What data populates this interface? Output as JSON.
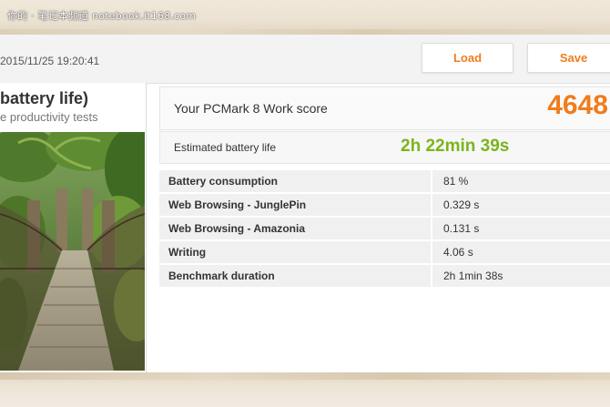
{
  "watermark": "你的 · 笔记本频道 notebook.it168.com",
  "header": {
    "timestamp": "2015/11/25 19:20:41",
    "load_label": "Load",
    "save_label": "Save"
  },
  "test": {
    "title": "battery life)",
    "subtitle": "e productivity tests"
  },
  "score": {
    "label": "Your PCMark 8 Work score",
    "value": "4648"
  },
  "battery": {
    "label": "Estimated battery life",
    "value": "2h 22min 39s"
  },
  "metrics": [
    {
      "name": "Battery consumption",
      "value": "81 %"
    },
    {
      "name": "Web Browsing - JunglePin",
      "value": "0.329 s"
    },
    {
      "name": "Web Browsing - Amazonia",
      "value": "0.131 s"
    },
    {
      "name": "Writing",
      "value": "4.06 s"
    },
    {
      "name": "Benchmark duration",
      "value": "2h 1min 38s"
    }
  ],
  "colors": {
    "accent_orange": "#f07c1d",
    "accent_green": "#7ab51d"
  }
}
